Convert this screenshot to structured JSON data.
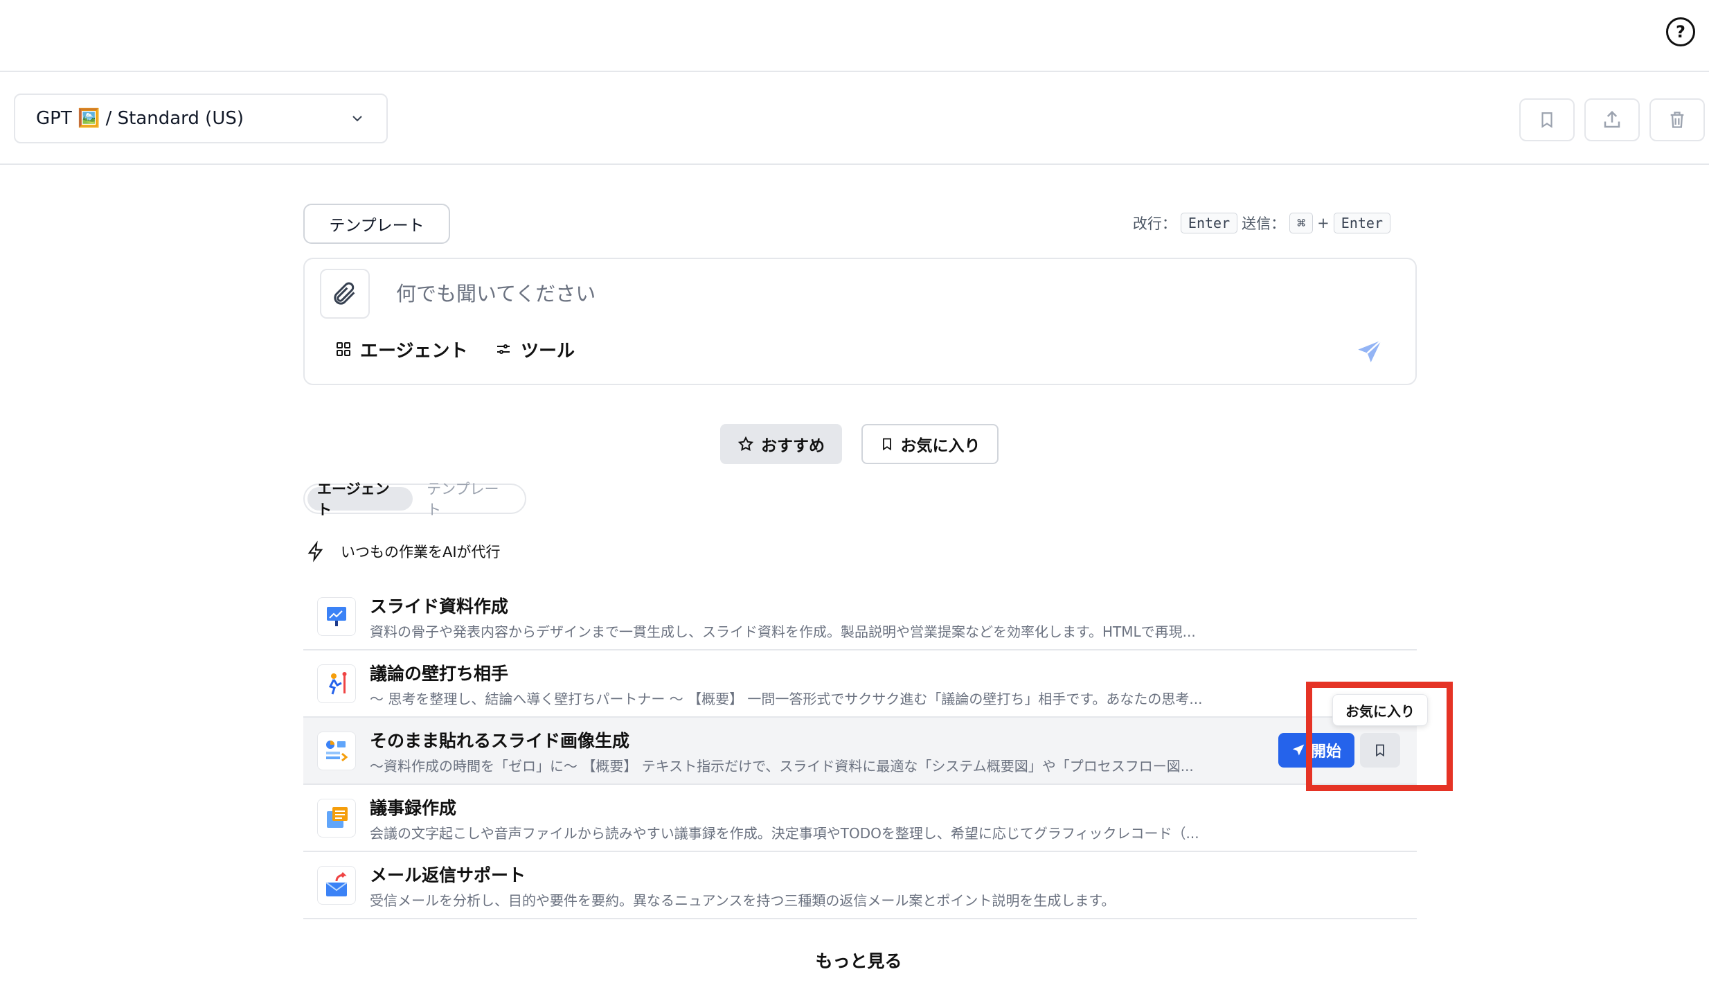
{
  "header": {
    "help_icon": "help-circle-icon",
    "model_selector": "GPT 🖼️ / Standard (US)",
    "actions": [
      "bookmark-icon",
      "share-icon",
      "trash-icon"
    ]
  },
  "composer": {
    "template_button": "テンプレート",
    "shortcut": {
      "newline_label": "改行：",
      "newline_key": "Enter",
      "send_label": "送信：",
      "send_mod": "⌘",
      "plus": "+",
      "send_key": "Enter"
    },
    "placeholder": "何でも聞いてください",
    "agent_label": "エージェント",
    "tools_label": "ツール"
  },
  "tabs": {
    "recommended": "おすすめ",
    "favorites": "お気に入り"
  },
  "toggle": {
    "agents": "エージェント",
    "templates": "テンプレート"
  },
  "section": {
    "title": "いつもの作業をAIが代行"
  },
  "items": [
    {
      "title": "スライド資料作成",
      "desc": "資料の骨子や発表内容からデザインまで一貫生成し、スライド資料を作成。製品説明や営業提案などを効率化します。HTMLで再現..."
    },
    {
      "title": "議論の壁打ち相手",
      "desc": "〜 思考を整理し、結論へ導く壁打ちパートナー 〜 【概要】 一問一答形式でサクサク進む「議論の壁打ち」相手です。あなたの思考..."
    },
    {
      "title": "そのまま貼れるスライド画像生成",
      "desc": "〜資料作成の時間を「ゼロ」に〜 【概要】 テキスト指示だけで、スライド資料に最適な「システム概要図」や「プロセスフロー図..."
    },
    {
      "title": "議事録作成",
      "desc": "会議の文字起こしや音声ファイルから読みやすい議事録を作成。決定事項やTODOを整理し、希望に応じてグラフィックレコード（..."
    },
    {
      "title": "メール返信サポート",
      "desc": "受信メールを分析し、目的や要件を要約。異なるニュアンスを持つ三種類の返信メール案とポイント説明を生成します。"
    }
  ],
  "hover_actions": {
    "start": "開始",
    "tooltip": "お気に入り"
  },
  "more": "もっと見る",
  "colors": {
    "primary": "#2563eb",
    "highlight": "#e53325",
    "border": "#e5e7eb"
  }
}
